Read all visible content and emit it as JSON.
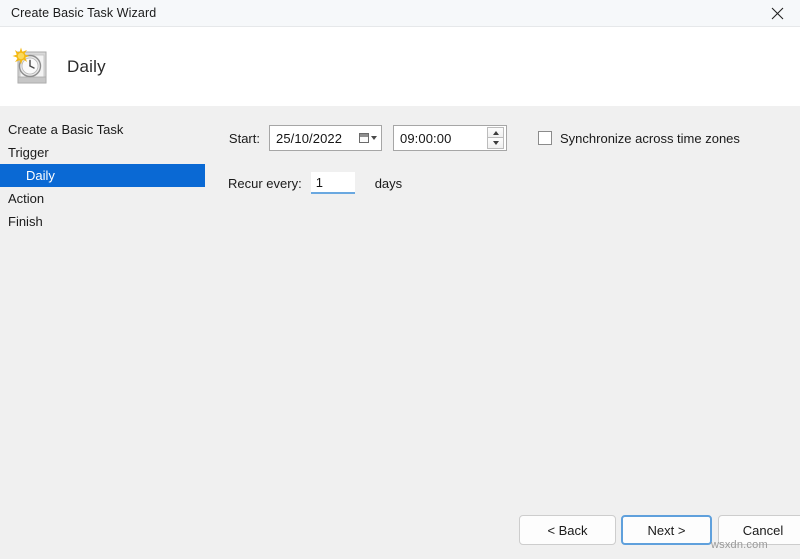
{
  "window": {
    "title": "Create Basic Task Wizard",
    "close_icon": "close-icon"
  },
  "header": {
    "title": "Daily",
    "icon": "task-scheduler-daily-icon"
  },
  "sidebar": {
    "items": [
      {
        "label": "Create a Basic Task",
        "selected": false,
        "child": false
      },
      {
        "label": "Trigger",
        "selected": false,
        "child": false
      },
      {
        "label": "Daily",
        "selected": true,
        "child": true
      },
      {
        "label": "Action",
        "selected": false,
        "child": false
      },
      {
        "label": "Finish",
        "selected": false,
        "child": false
      }
    ],
    "selected_bg": "#0a69d4"
  },
  "main": {
    "start_label": "Start:",
    "start_date": "25/10/2022",
    "start_date_picker_icon": "calendar-dropdown-icon",
    "start_time": "09:00:00",
    "time_spinner_up_icon": "spinner-up-icon",
    "time_spinner_down_icon": "spinner-down-icon",
    "sync_label": "Synchronize across time zones",
    "sync_checked": false,
    "recur_label": "Recur every:",
    "recur_value": "1",
    "recur_unit": "days"
  },
  "footer": {
    "back_label": "< Back",
    "next_label": "Next >",
    "cancel_label": "Cancel",
    "default_button_accent": "#5fa0dc"
  },
  "watermark": {
    "text": "wsxdn.com"
  }
}
